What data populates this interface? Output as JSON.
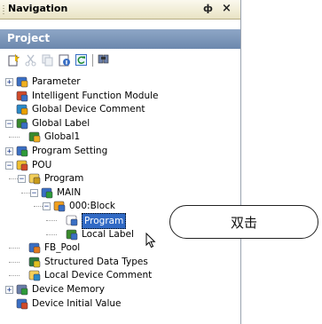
{
  "navigation": {
    "title": "Navigation",
    "pin_glyph": "ф",
    "close_glyph": "×"
  },
  "project": {
    "header": "Project"
  },
  "toolbar": {
    "buttons": [
      "new-data-icon",
      "cut-icon",
      "copy-icon",
      "properties-icon",
      "refresh-icon",
      "find-icon"
    ]
  },
  "tree": {
    "items": [
      {
        "label": "Parameter",
        "icon": "parameter-icon",
        "expander": "+"
      },
      {
        "label": "Intelligent Function Module",
        "icon": "module-icon"
      },
      {
        "label": "Global Device Comment",
        "icon": "comment-icon"
      },
      {
        "label": "Global Label",
        "icon": "label-icon",
        "expander": "−"
      },
      {
        "label": "Global1",
        "icon": "label-table-icon"
      },
      {
        "label": "Program Setting",
        "icon": "program-setting-icon",
        "expander": "+"
      },
      {
        "label": "POU",
        "icon": "pou-icon",
        "expander": "−"
      },
      {
        "label": "Program",
        "icon": "folder-icon",
        "expander": "−"
      },
      {
        "label": "MAIN",
        "icon": "main-icon",
        "expander": "−"
      },
      {
        "label": "000:Block",
        "icon": "block-icon",
        "expander": "−"
      },
      {
        "label": "Program",
        "icon": "program-body-icon",
        "selected": true
      },
      {
        "label": "Local Label",
        "icon": "local-label-icon"
      },
      {
        "label": "FB_Pool",
        "icon": "fb-pool-icon"
      },
      {
        "label": "Structured Data Types",
        "icon": "structured-icon"
      },
      {
        "label": "Local Device Comment",
        "icon": "comment-folder-icon"
      },
      {
        "label": "Device Memory",
        "icon": "device-memory-icon",
        "expander": "+"
      },
      {
        "label": "Device Initial Value",
        "icon": "device-initial-icon"
      }
    ]
  },
  "callout": {
    "text": "双击"
  },
  "colors": {
    "header_bg": "#7b94b8",
    "selection": "#316ac5",
    "titlebar": "#f1ecd5"
  }
}
